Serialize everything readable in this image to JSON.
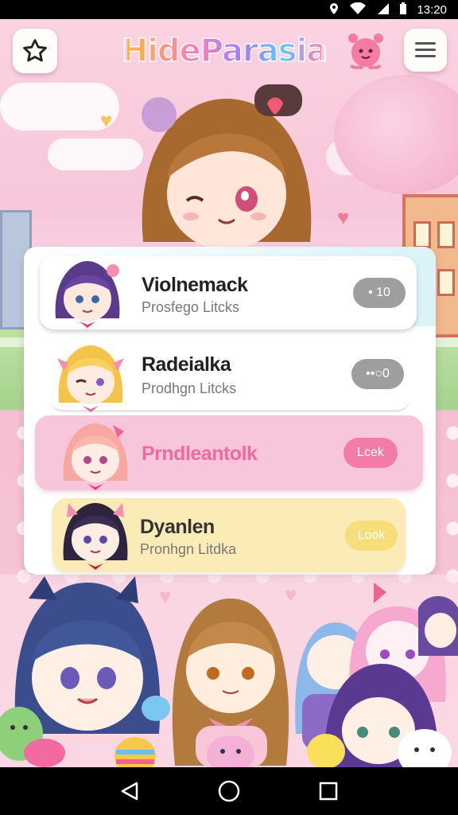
{
  "status_bar": {
    "time": "13:20"
  },
  "header": {
    "title": "HideParasia",
    "star_icon": "star-outline-icon",
    "menu_icon": "hamburger-menu-icon",
    "mascot_icon": "pink-octopus-mascot"
  },
  "characters": [
    {
      "name": "Violnemack",
      "subtitle": "Prosfego Litcks",
      "action": "• 10",
      "action_color": "#9e9e9e",
      "card_color": "#ffffff",
      "name_color": "#222222"
    },
    {
      "name": "Radeialka",
      "subtitle": "Prodhgn Litcks",
      "action": "••○0",
      "action_color": "#9e9e9e",
      "card_color": "#ffffff",
      "name_color": "#222222"
    },
    {
      "name": "Prndleantolk",
      "subtitle": "",
      "action": "Lcek",
      "action_color": "#f27ca7",
      "card_color": "#f8c6da",
      "name_color": "#ee6aa1"
    },
    {
      "name": "Dyanlen",
      "subtitle": "Pronhgn Litdka",
      "action": "Look",
      "action_color": "#f6de7a",
      "card_color": "#fbecb7",
      "name_color": "#333333"
    }
  ],
  "colors": {
    "accent": "#f27ca7",
    "background": "#fbd3e2"
  },
  "nav": {
    "back_icon": "back-triangle-icon",
    "home_icon": "home-circle-icon",
    "recents_icon": "recents-square-icon"
  }
}
